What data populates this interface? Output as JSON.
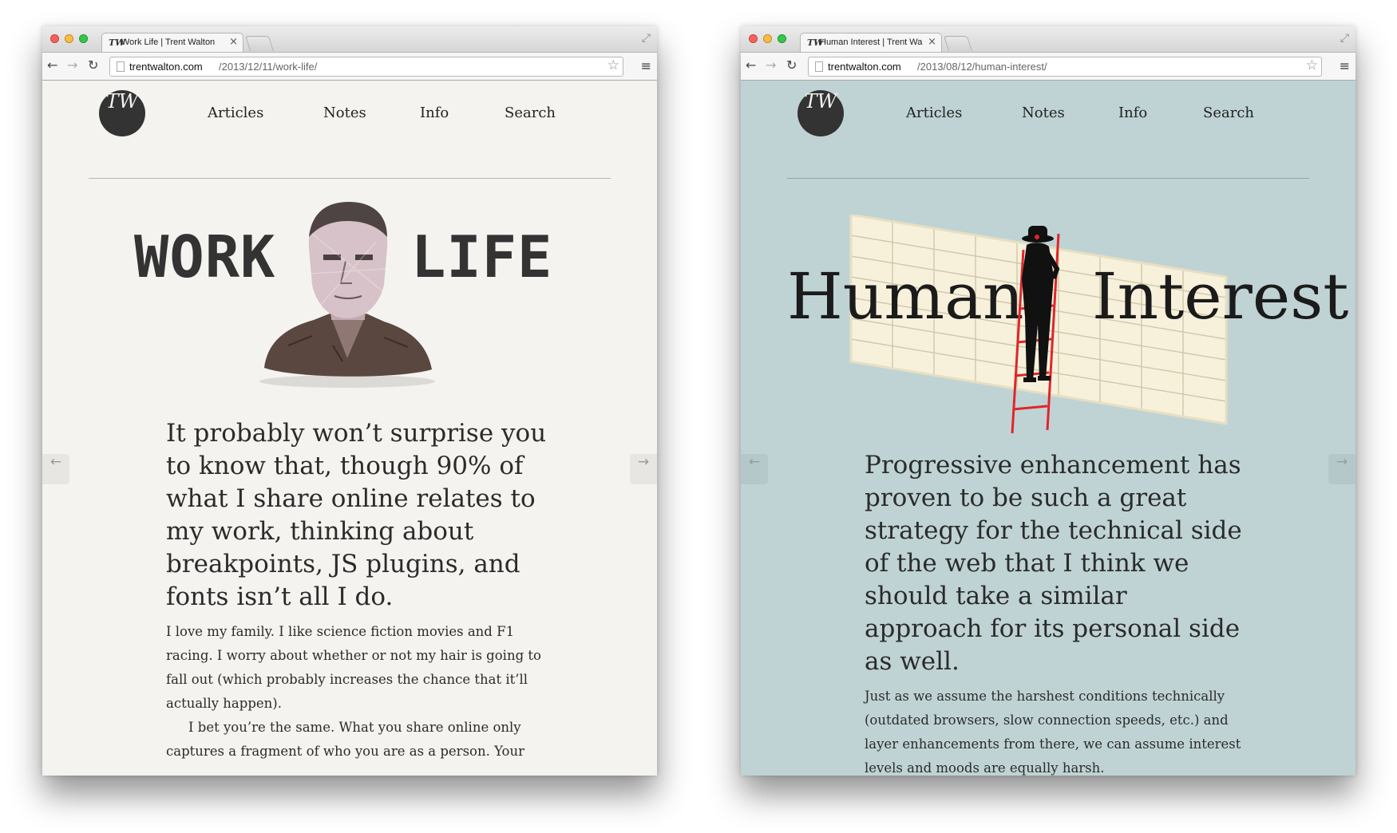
{
  "windows": [
    {
      "tab": {
        "title": "Work Life | Trent Walton",
        "close": "×",
        "favicon": "TW"
      },
      "url": {
        "domain": "trentwalton.com",
        "path": "/2013/12/11/work-life/"
      },
      "site": {
        "logo": "TW",
        "nav": [
          "Articles",
          "Notes",
          "Info",
          "Search"
        ]
      },
      "hero": {
        "word1": "WORK",
        "word2": "LIFE"
      },
      "article": {
        "lede": "It probably won’t surprise you to know that, though 90% of what I share online relates to my work, thinking about breakpoints, JS plugins, and fonts isn’t all I do.",
        "paragraphs": [
          "I love my family. I like science fiction movies and F1 racing. I worry about whether or not my hair is going to fall out (which probably increases the chance that it’ll actually happen).",
          "I bet you’re the same. What you share online only captures a fragment of who you are as a person. Your"
        ]
      },
      "icons": {
        "back": "←",
        "forward": "→",
        "reload": "↻",
        "star": "☆",
        "menu": "≡",
        "expand": "⤢",
        "prev": "←",
        "next": "→"
      }
    },
    {
      "tab": {
        "title": "Human Interest | Trent Wa",
        "close": "×",
        "favicon": "TW"
      },
      "url": {
        "domain": "trentwalton.com",
        "path": "/2013/08/12/human-interest/"
      },
      "site": {
        "logo": "TW",
        "nav": [
          "Articles",
          "Notes",
          "Info",
          "Search"
        ]
      },
      "hero": {
        "word1": "Human",
        "word2": "Interest"
      },
      "article": {
        "lede": "Progressive enhancement has proven to be such a great strategy for the technical side of the web that I think we should take a similar approach for its personal side as well.",
        "paragraphs": [
          "Just as we assume the harshest conditions technically (outdated browsers, slow connection speeds, etc.) and layer enhancements from there, we can assume interest levels and moods are equally harsh."
        ]
      },
      "icons": {
        "back": "←",
        "forward": "→",
        "reload": "↻",
        "star": "☆",
        "menu": "≡",
        "expand": "⤢",
        "prev": "←",
        "next": "→"
      }
    }
  ],
  "colors": {
    "left_bg": "#f4f3f0",
    "right_bg": "#bfd3d4",
    "ink": "#2b2b2b",
    "ladder": "#e0252a",
    "wall": "#f7f1dc"
  }
}
